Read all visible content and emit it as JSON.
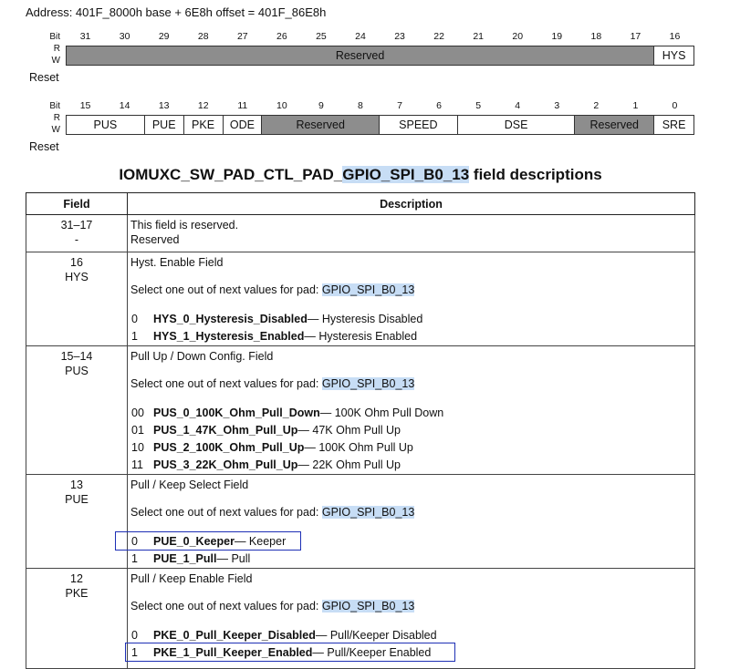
{
  "address_line": "Address: 401F_8000h base + 6E8h offset = 401F_86E8h",
  "register_upper": {
    "bit_label": "Bit",
    "rw_label_r": "R",
    "rw_label_w": "W",
    "reset_label": "Reset",
    "bits": [
      "31",
      "30",
      "29",
      "28",
      "27",
      "26",
      "25",
      "24",
      "23",
      "22",
      "21",
      "20",
      "19",
      "18",
      "17",
      "16"
    ],
    "fields": [
      {
        "name": "Reserved",
        "reserved": true
      },
      {
        "name": "HYS",
        "reserved": false
      }
    ]
  },
  "register_lower": {
    "bit_label": "Bit",
    "rw_label_r": "R",
    "rw_label_w": "W",
    "reset_label": "Reset",
    "bits": [
      "15",
      "14",
      "13",
      "12",
      "11",
      "10",
      "9",
      "8",
      "7",
      "6",
      "5",
      "4",
      "3",
      "2",
      "1",
      "0"
    ],
    "fields": [
      {
        "name": "PUS",
        "reserved": false
      },
      {
        "name": "PUE",
        "reserved": false
      },
      {
        "name": "PKE",
        "reserved": false
      },
      {
        "name": "ODE",
        "reserved": false
      },
      {
        "name": "Reserved",
        "reserved": true
      },
      {
        "name": "SPEED",
        "reserved": false
      },
      {
        "name": "DSE",
        "reserved": false
      },
      {
        "name": "Reserved",
        "reserved": true
      },
      {
        "name": "SRE",
        "reserved": false
      }
    ]
  },
  "table_title": {
    "prefix": "IOMUXC_SW_PAD_CTL_PAD_",
    "pad": "GPIO_SPI_B0_13",
    "suffix": " field descriptions"
  },
  "table": {
    "headers": [
      "Field",
      "Description"
    ],
    "select_prefix": "Select one out of next values for pad: ",
    "pad_name": "GPIO_SPI_B0_13",
    "rows": [
      {
        "field_bits": "31–17",
        "field_name": "-",
        "title": "This field is reserved.",
        "extra": "Reserved",
        "values": []
      },
      {
        "field_bits": "16",
        "field_name": "HYS",
        "title": "Hyst. Enable Field",
        "values": [
          {
            "code": "0",
            "name": "HYS_0_Hysteresis_Disabled",
            "desc": " — Hysteresis Disabled"
          },
          {
            "code": "1",
            "name": "HYS_1_Hysteresis_Enabled",
            "desc": " — Hysteresis Enabled"
          }
        ]
      },
      {
        "field_bits": "15–14",
        "field_name": "PUS",
        "title": "Pull Up / Down Config. Field",
        "values": [
          {
            "code": "00",
            "name": "PUS_0_100K_Ohm_Pull_Down",
            "desc": " — 100K Ohm Pull Down"
          },
          {
            "code": "01",
            "name": "PUS_1_47K_Ohm_Pull_Up",
            "desc": " — 47K Ohm Pull Up"
          },
          {
            "code": "10",
            "name": "PUS_2_100K_Ohm_Pull_Up",
            "desc": " — 100K Ohm Pull Up"
          },
          {
            "code": "11",
            "name": "PUS_3_22K_Ohm_Pull_Up",
            "desc": " — 22K Ohm Pull Up"
          }
        ]
      },
      {
        "field_bits": "13",
        "field_name": "PUE",
        "title": "Pull / Keep Select Field",
        "values": [
          {
            "code": "0",
            "name": "PUE_0_Keeper",
            "desc": " — Keeper",
            "boxed": true
          },
          {
            "code": "1",
            "name": "PUE_1_Pull",
            "desc": " — Pull"
          }
        ]
      },
      {
        "field_bits": "12",
        "field_name": "PKE",
        "title": "Pull / Keep Enable Field",
        "values": [
          {
            "code": "0",
            "name": "PKE_0_Pull_Keeper_Disabled",
            "desc": " — Pull/Keeper Disabled"
          },
          {
            "code": "1",
            "name": "PKE_1_Pull_Keeper_Enabled",
            "desc": " — Pull/Keeper Enabled",
            "boxed": true
          }
        ]
      }
    ]
  },
  "colors": {
    "reserved_gray": "#8d8d8d",
    "highlight": "#c7ddf5",
    "box_outline": "#1d2fb5"
  }
}
